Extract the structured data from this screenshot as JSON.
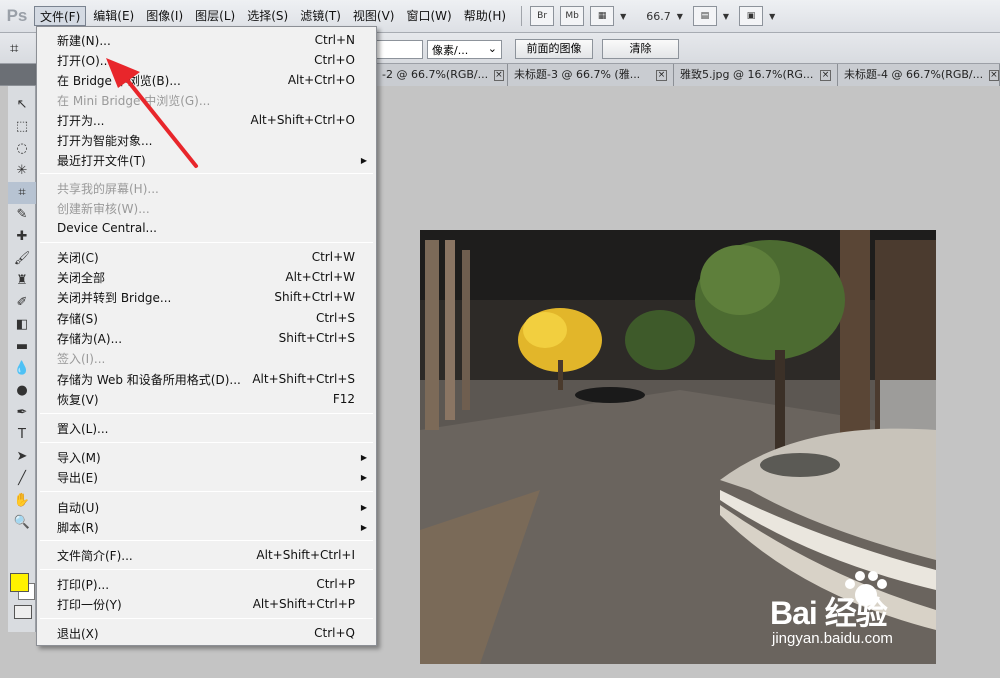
{
  "menubar": {
    "logo": "Ps",
    "items": [
      "文件(F)",
      "编辑(E)",
      "图像(I)",
      "图层(L)",
      "选择(S)",
      "滤镜(T)",
      "视图(V)",
      "窗口(W)",
      "帮助(H)"
    ],
    "br": "Br",
    "mb": "Mb",
    "zoom": "66.7"
  },
  "options": {
    "unit": "像素/...",
    "front_image": "前面的图像",
    "clear": "清除"
  },
  "tabs": [
    {
      "label": "-2 @ 66.7%(RGB/..."
    },
    {
      "label": "未标题-3 @ 66.7% (雅..."
    },
    {
      "label": "雅致5.jpg @ 16.7%(RG..."
    },
    {
      "label": "未标题-4 @ 66.7%(RGB/..."
    }
  ],
  "file_menu": [
    {
      "label": "新建(N)...",
      "shortcut": "Ctrl+N"
    },
    {
      "label": "打开(O)...",
      "shortcut": "Ctrl+O"
    },
    {
      "label": "在 Bridge 中浏览(B)...",
      "shortcut": "Alt+Ctrl+O"
    },
    {
      "label": "在 Mini Bridge 中浏览(G)...",
      "shortcut": "",
      "disabled": true
    },
    {
      "label": "打开为...",
      "shortcut": "Alt+Shift+Ctrl+O"
    },
    {
      "label": "打开为智能对象...",
      "shortcut": ""
    },
    {
      "label": "最近打开文件(T)",
      "shortcut": "",
      "submenu": true
    },
    {
      "label": "共享我的屏幕(H)...",
      "shortcut": "",
      "disabled": true
    },
    {
      "label": "创建新审核(W)...",
      "shortcut": "",
      "disabled": true
    },
    {
      "label": "Device Central...",
      "shortcut": ""
    },
    {
      "label": "关闭(C)",
      "shortcut": "Ctrl+W"
    },
    {
      "label": "关闭全部",
      "shortcut": "Alt+Ctrl+W"
    },
    {
      "label": "关闭并转到 Bridge...",
      "shortcut": "Shift+Ctrl+W"
    },
    {
      "label": "存储(S)",
      "shortcut": "Ctrl+S"
    },
    {
      "label": "存储为(A)...",
      "shortcut": "Shift+Ctrl+S"
    },
    {
      "label": "签入(I)...",
      "shortcut": "",
      "disabled": true
    },
    {
      "label": "存储为 Web 和设备所用格式(D)...",
      "shortcut": "Alt+Shift+Ctrl+S"
    },
    {
      "label": "恢复(V)",
      "shortcut": "F12"
    },
    {
      "label": "置入(L)...",
      "shortcut": ""
    },
    {
      "label": "导入(M)",
      "shortcut": "",
      "submenu": true
    },
    {
      "label": "导出(E)",
      "shortcut": "",
      "submenu": true
    },
    {
      "label": "自动(U)",
      "shortcut": "",
      "submenu": true
    },
    {
      "label": "脚本(R)",
      "shortcut": "",
      "submenu": true
    },
    {
      "label": "文件简介(F)...",
      "shortcut": "Alt+Shift+Ctrl+I"
    },
    {
      "label": "打印(P)...",
      "shortcut": "Ctrl+P"
    },
    {
      "label": "打印一份(Y)",
      "shortcut": "Alt+Shift+Ctrl+P"
    },
    {
      "label": "退出(X)",
      "shortcut": "Ctrl+Q"
    }
  ],
  "watermark": {
    "brand": "Bai 经验",
    "url": "jingyan.baidu.com"
  },
  "colors": {
    "foreground": "#fff200",
    "arrow": "#e8262b"
  }
}
